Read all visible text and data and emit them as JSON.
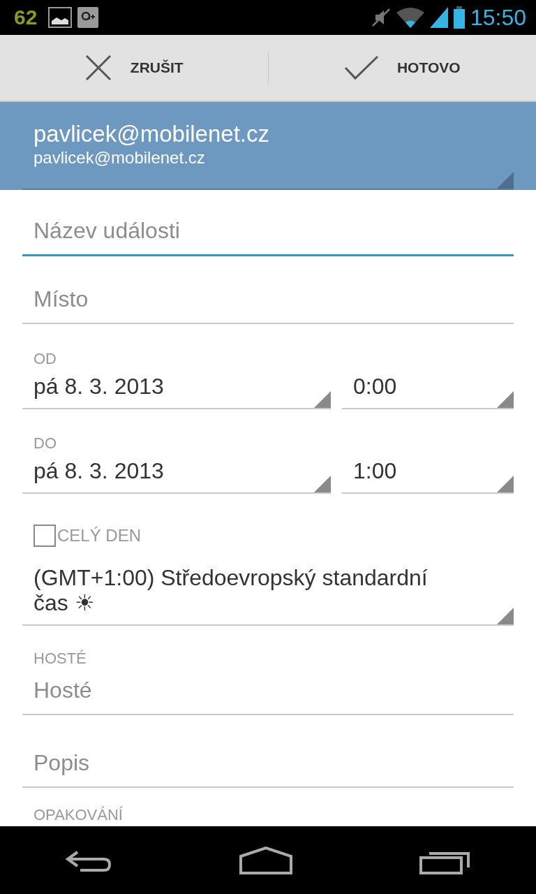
{
  "status_bar": {
    "notification_count": "62",
    "time": "15:50"
  },
  "action_bar": {
    "buttons": [
      {
        "kind": "cancel",
        "label": "ZRUŠIT"
      },
      {
        "kind": "done",
        "label": "HOTOVO"
      }
    ]
  },
  "account": {
    "name": "pavlicek@mobilenet.cz",
    "email": "pavlicek@mobilenet.cz"
  },
  "title_field": {
    "placeholder": "Název události",
    "focused": true
  },
  "location_field": {
    "placeholder": "Místo",
    "focused": false
  },
  "from": {
    "label": "OD",
    "date": "pá 8. 3. 2013",
    "time": "0:00"
  },
  "to": {
    "label": "DO",
    "date": "pá 8. 3. 2013",
    "time": "1:00"
  },
  "all_day": {
    "label": "CELÝ DEN",
    "checked": false
  },
  "timezone": "(GMT+1:00) Středoevropský standardní čas ☀",
  "guests": {
    "label": "HOSTÉ",
    "placeholder": "Hosté"
  },
  "description_field": {
    "placeholder": "Popis"
  },
  "recurrence": {
    "label": "OPAKOVÁNÍ"
  }
}
